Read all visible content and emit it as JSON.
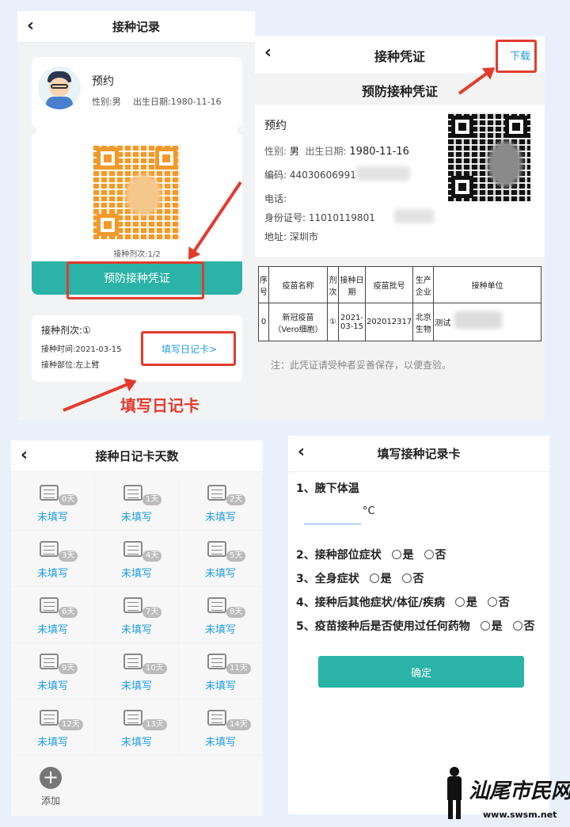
{
  "panel1": {
    "title": "接种记录",
    "name": "预约",
    "gender": "性别:男",
    "birth": "出生日期:1980-11-16",
    "dose_count": "接种剂次:1/2",
    "button": "预防接种凭证",
    "record_title": "接种剂次:①",
    "record_time": "接种时间:2021-03-15",
    "record_site": "接种部位:左上臂",
    "diary_link": "填写日记卡>",
    "annotation": "填写日记卡"
  },
  "panel2": {
    "title": "接种凭证",
    "download": "下载",
    "cert_title": "预防接种凭证",
    "name": "预约",
    "gender_label": "性别:",
    "gender": "男",
    "birth_label": "出生日期:",
    "birth": "1980-11-16",
    "code": "编码: 44030606991",
    "phone": "电话:",
    "id_number": "身份证号: 11010119801",
    "address": "地址: 深圳市",
    "table_headers": [
      "序号",
      "疫苗名称",
      "剂次",
      "接种日期",
      "疫苗批号",
      "生产企业",
      "接种单位"
    ],
    "table_row": [
      "0",
      "新冠疫苗（Vero细胞）",
      "①",
      "2021-03-15",
      "202012317",
      "北京生物",
      "测试"
    ],
    "note": "注：此凭证请受种者妥善保存，以便查验。"
  },
  "panel3": {
    "title": "接种日记卡天数",
    "days": [
      "0天",
      "1天",
      "2天",
      "3天",
      "4天",
      "5天",
      "6天",
      "7天",
      "8天",
      "9天",
      "10天",
      "11天",
      "12天",
      "13天",
      "14天"
    ],
    "status": "未填写",
    "add_label": "添加"
  },
  "panel4": {
    "title": "填写接种记录卡",
    "q1": "1、腋下体温",
    "unit": "°C",
    "q2": "2、接种部位症状",
    "q3": "3、全身症状",
    "q4": "4、接种后其他症状/体征/疾病",
    "q5": "5、疫苗接种后是否使用过任何药物",
    "yes": "是",
    "no": "否",
    "confirm": "确定"
  },
  "watermark": {
    "text": "汕尾市民网",
    "url": "www.swsm.net"
  },
  "colors": {
    "teal": "#2bb3a7",
    "red": "#e23b2e",
    "blue": "#1f9de0"
  }
}
